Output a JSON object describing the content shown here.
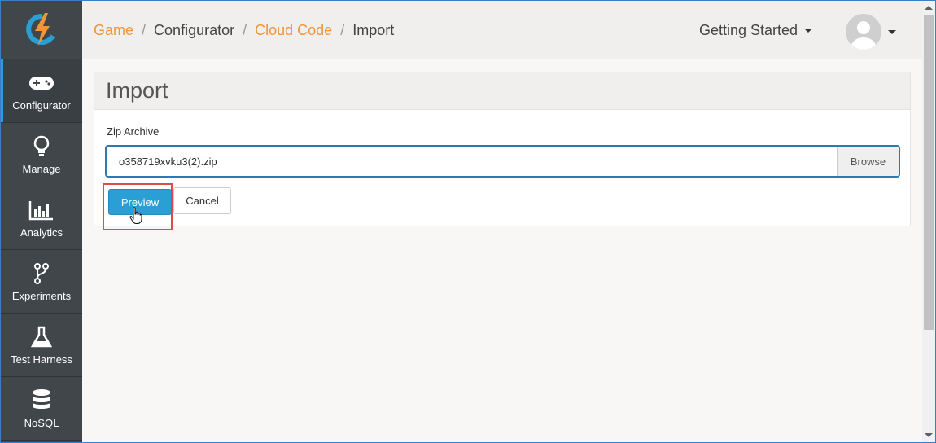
{
  "sidebar": {
    "logo": "lightning-logo",
    "items": [
      {
        "label": "Configurator",
        "icon": "gamepad-icon",
        "active": true
      },
      {
        "label": "Manage",
        "icon": "lightbulb-icon"
      },
      {
        "label": "Analytics",
        "icon": "bar-chart-icon"
      },
      {
        "label": "Experiments",
        "icon": "branch-icon"
      },
      {
        "label": "Test Harness",
        "icon": "flask-icon"
      },
      {
        "label": "NoSQL",
        "icon": "database-icon"
      }
    ]
  },
  "header": {
    "breadcrumb": [
      {
        "label": "Game",
        "link": true
      },
      {
        "label": "Configurator",
        "link": false
      },
      {
        "label": "Cloud Code",
        "link": true
      },
      {
        "label": "Import",
        "link": false
      }
    ],
    "separator": "/",
    "getting_started": "Getting Started"
  },
  "panel": {
    "title": "Import",
    "field_label": "Zip Archive",
    "file_value": "o358719xvku3(2).zip",
    "browse_label": "Browse",
    "preview_label": "Preview",
    "cancel_label": "Cancel"
  },
  "colors": {
    "accent": "#2a9fd6",
    "link": "#f0953a",
    "sidebar": "#41464b",
    "highlight": "#e04a4a"
  }
}
